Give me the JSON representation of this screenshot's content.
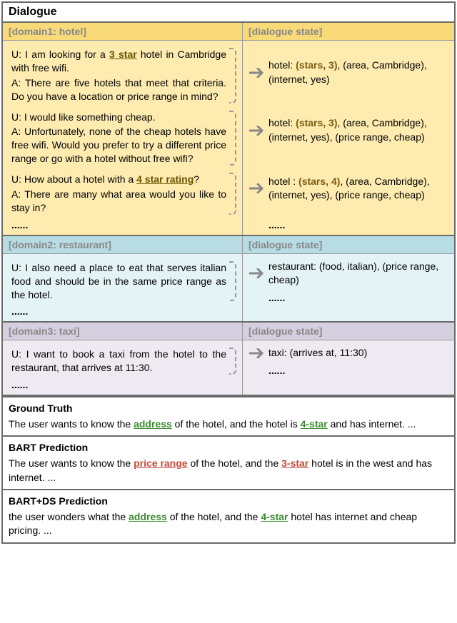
{
  "title": "Dialogue",
  "domains": {
    "hotel": {
      "header_left": "[domain1: hotel]",
      "header_right": "[dialogue state]",
      "turns": [
        {
          "u_pre": "U: I am looking for a ",
          "u_key": "3 star",
          "u_post": " hotel in Cambridge with free wifi.",
          "a": "A: There are five hotels that meet that criteria. Do you have a location or price range in mind?",
          "state_prefix": "hotel: ",
          "state_bold": "(stars, 3)",
          "state_rest": ", (area, Cambridge), (internet, yes)"
        },
        {
          "u_plain": "U: I would like something cheap.",
          "a": "A: Unfortunately, none of the cheap hotels have free wifi.  Would you prefer to try a different price range or go with a hotel without free wifi?",
          "state_prefix": "hotel: ",
          "state_bold": "(stars, 3)",
          "state_rest": ", (area, Cambridge), (internet, yes), (price range, cheap)"
        },
        {
          "u_pre": "U: How about a hotel with a ",
          "u_key": "4 star rating",
          "u_post": "?",
          "a": "A: There are many what area would you like to stay in?",
          "state_prefix": "hotel : ",
          "state_bold": "(stars, 4)",
          "state_rest": ", (area, Cambridge), (internet, yes), (price range, cheap)"
        }
      ],
      "ellipsis": "......"
    },
    "restaurant": {
      "header_left": "[domain2: restaurant]",
      "header_right": "[dialogue state]",
      "u": "U: I also need a place to eat that serves italian food and should be in the same price range as the hotel.",
      "state": "restaurant: (food, italian), (price range, cheap)",
      "ellipsis": "......"
    },
    "taxi": {
      "header_left": "[domain3: taxi]",
      "header_right": "[dialogue state]",
      "u": "U: I want to book a taxi from the hotel to the restaurant, that arrives at 11:30.",
      "state": "taxi: (arrives at, 11:30)",
      "ellipsis": "......"
    }
  },
  "results": {
    "gt": {
      "title": "Ground Truth",
      "pre": "The user wants to know the ",
      "k1": "address",
      "mid": " of the hotel, and the hotel is ",
      "k2": "4-star",
      "post": " and has internet. ..."
    },
    "bart": {
      "title": "BART Prediction",
      "pre": "The user wants to know the ",
      "k1": "price range",
      "mid": " of the hotel, and the ",
      "k2": "3-star",
      "post": " hotel is in the west and has internet. ..."
    },
    "bartds": {
      "title": "BART+DS Prediction",
      "pre": "the user wonders what the ",
      "k1": "address",
      "mid": " of the hotel,  and the ",
      "k2": "4-star",
      "post": " hotel has internet and cheap pricing. ..."
    }
  }
}
